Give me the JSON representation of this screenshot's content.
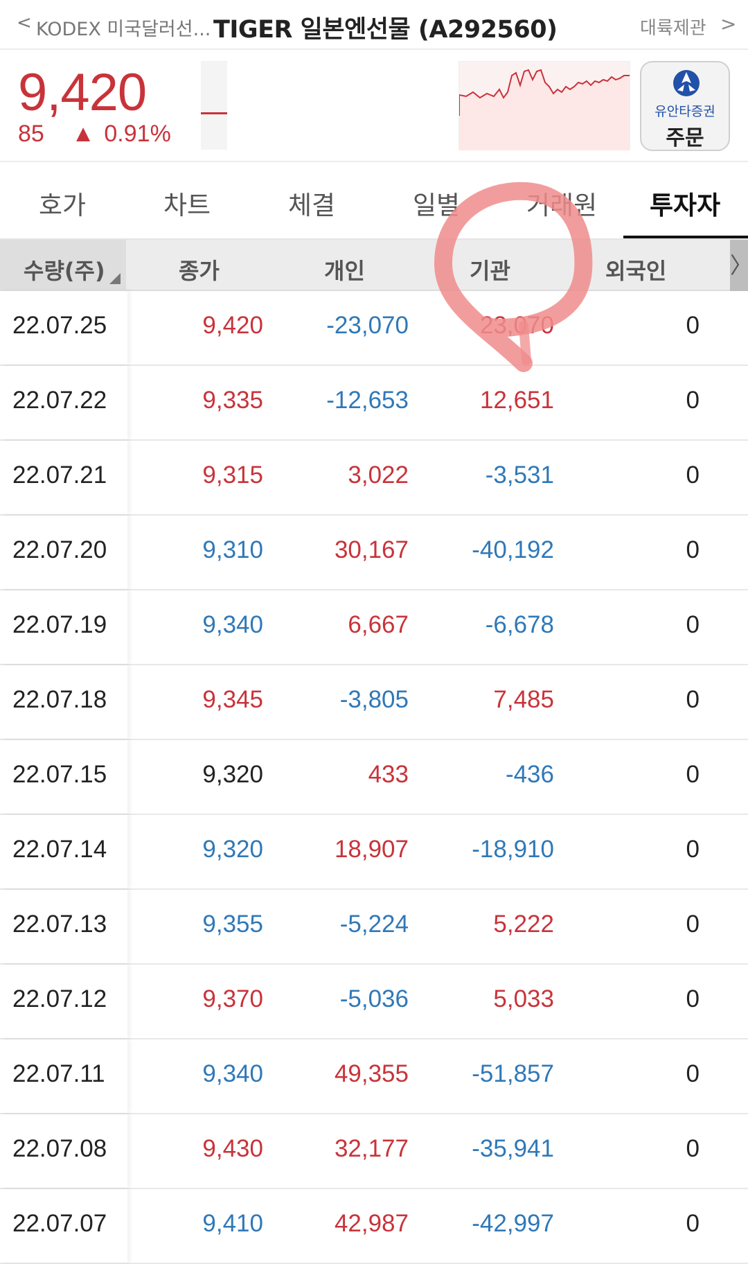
{
  "topbar": {
    "back_glyph": "<",
    "prev_item": "KODEX 미국달러선...",
    "title": "TIGER 일본엔선물 (A292560)",
    "next_item": "대륙제관",
    "next_glyph": ">"
  },
  "quote": {
    "price": "9,420",
    "change": "85",
    "change_glyph": "▲",
    "change_pct": "0.91%",
    "order_button": {
      "brand": "유안타증권",
      "label": "주문"
    }
  },
  "tabs": [
    {
      "label": "호가",
      "active": false
    },
    {
      "label": "차트",
      "active": false
    },
    {
      "label": "체결",
      "active": false
    },
    {
      "label": "일별",
      "active": false
    },
    {
      "label": "거래원",
      "active": false
    },
    {
      "label": "투자자",
      "active": true
    }
  ],
  "table": {
    "headers": [
      "수량(주)",
      "종가",
      "개인",
      "기관",
      "외국인"
    ],
    "scroll_glyph": "〉",
    "rows": [
      {
        "date": "22.07.25",
        "close": "9,420",
        "close_dir": "up",
        "indiv": "-23,070",
        "indiv_dir": "down",
        "inst": "23,070",
        "inst_dir": "up",
        "foreign": "0"
      },
      {
        "date": "22.07.22",
        "close": "9,335",
        "close_dir": "up",
        "indiv": "-12,653",
        "indiv_dir": "down",
        "inst": "12,651",
        "inst_dir": "up",
        "foreign": "0"
      },
      {
        "date": "22.07.21",
        "close": "9,315",
        "close_dir": "up",
        "indiv": "3,022",
        "indiv_dir": "up",
        "inst": "-3,531",
        "inst_dir": "down",
        "foreign": "0"
      },
      {
        "date": "22.07.20",
        "close": "9,310",
        "close_dir": "down",
        "indiv": "30,167",
        "indiv_dir": "up",
        "inst": "-40,192",
        "inst_dir": "down",
        "foreign": "0"
      },
      {
        "date": "22.07.19",
        "close": "9,340",
        "close_dir": "down",
        "indiv": "6,667",
        "indiv_dir": "up",
        "inst": "-6,678",
        "inst_dir": "down",
        "foreign": "0"
      },
      {
        "date": "22.07.18",
        "close": "9,345",
        "close_dir": "up",
        "indiv": "-3,805",
        "indiv_dir": "down",
        "inst": "7,485",
        "inst_dir": "up",
        "foreign": "0"
      },
      {
        "date": "22.07.15",
        "close": "9,320",
        "close_dir": "flat",
        "indiv": "433",
        "indiv_dir": "up",
        "inst": "-436",
        "inst_dir": "down",
        "foreign": "0"
      },
      {
        "date": "22.07.14",
        "close": "9,320",
        "close_dir": "down",
        "indiv": "18,907",
        "indiv_dir": "up",
        "inst": "-18,910",
        "inst_dir": "down",
        "foreign": "0"
      },
      {
        "date": "22.07.13",
        "close": "9,355",
        "close_dir": "down",
        "indiv": "-5,224",
        "indiv_dir": "down",
        "inst": "5,222",
        "inst_dir": "up",
        "foreign": "0"
      },
      {
        "date": "22.07.12",
        "close": "9,370",
        "close_dir": "up",
        "indiv": "-5,036",
        "indiv_dir": "down",
        "inst": "5,033",
        "inst_dir": "up",
        "foreign": "0"
      },
      {
        "date": "22.07.11",
        "close": "9,340",
        "close_dir": "down",
        "indiv": "49,355",
        "indiv_dir": "up",
        "inst": "-51,857",
        "inst_dir": "down",
        "foreign": "0"
      },
      {
        "date": "22.07.08",
        "close": "9,430",
        "close_dir": "up",
        "indiv": "32,177",
        "indiv_dir": "up",
        "inst": "-35,941",
        "inst_dir": "down",
        "foreign": "0"
      },
      {
        "date": "22.07.07",
        "close": "9,410",
        "close_dir": "down",
        "indiv": "42,987",
        "indiv_dir": "up",
        "inst": "-42,997",
        "inst_dir": "down",
        "foreign": "0"
      }
    ]
  },
  "colors": {
    "up": "#c8333a",
    "down": "#2f78b8",
    "annotation": "#f08c8c"
  },
  "icons": {
    "order_logo": "yuanta-logo-icon",
    "annotation": "hand-drawn-circle-mark"
  }
}
